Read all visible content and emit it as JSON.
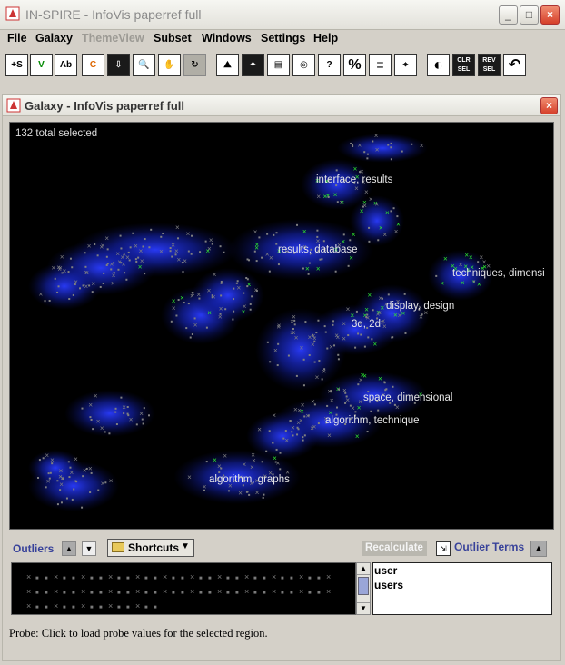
{
  "app": {
    "title": "IN-SPIRE - InfoVis paperref full"
  },
  "window_controls": {
    "minimize": "_",
    "maximize": "□",
    "close": "×"
  },
  "menu": [
    "File",
    "Galaxy",
    "ThemeView",
    "Subset",
    "Windows",
    "Settings",
    "Help"
  ],
  "menu_disabled": [
    "ThemeView"
  ],
  "toolbar": {
    "buttons": [
      {
        "name": "select-points",
        "label": "+S"
      },
      {
        "name": "select-rect",
        "label": "V"
      },
      {
        "name": "label-points",
        "label": "Ab"
      },
      {
        "name": "group-tool",
        "label": "C"
      },
      {
        "name": "drill-down",
        "label": "⇩"
      },
      {
        "name": "zoom",
        "label": "🔍"
      },
      {
        "name": "pan",
        "label": "✋"
      },
      {
        "name": "disabled-tool",
        "label": "↻"
      },
      {
        "name": "themeview",
        "label": "⛰"
      },
      {
        "name": "galaxy-view",
        "label": "✦"
      },
      {
        "name": "documents",
        "label": "▤"
      },
      {
        "name": "compare",
        "label": "◎"
      },
      {
        "name": "query",
        "label": "?"
      },
      {
        "name": "percent",
        "label": "%"
      },
      {
        "name": "summary",
        "label": "≡"
      },
      {
        "name": "probe",
        "label": "⌖"
      },
      {
        "name": "contrast",
        "label": "◐"
      },
      {
        "name": "clear-selection",
        "label": "CLR SEL"
      },
      {
        "name": "reverse-selection",
        "label": "REV SEL"
      },
      {
        "name": "undo",
        "label": "↶"
      }
    ]
  },
  "galaxy": {
    "title": "Galaxy - InfoVis paperref full",
    "selected_text": "132 total selected",
    "themes": [
      "interface, results",
      "results, database",
      "techniques, dimensi",
      "display, design",
      "3d, 2d",
      "space, dimensional",
      "algorithm, technique",
      "algorithm, graphs"
    ]
  },
  "outliers": {
    "label": "Outliers",
    "shortcuts_label": "Shortcuts",
    "recalculate_label": "Recalculate",
    "terms_label": "Outlier Terms",
    "terms": [
      "user",
      "users"
    ]
  },
  "status": "Probe: Click to load probe values for the selected region.",
  "colors": {
    "accent": "#38429a",
    "cluster": "#1b2cff",
    "selected": "#2ee62e",
    "point": "#808080",
    "background": "#000000"
  }
}
